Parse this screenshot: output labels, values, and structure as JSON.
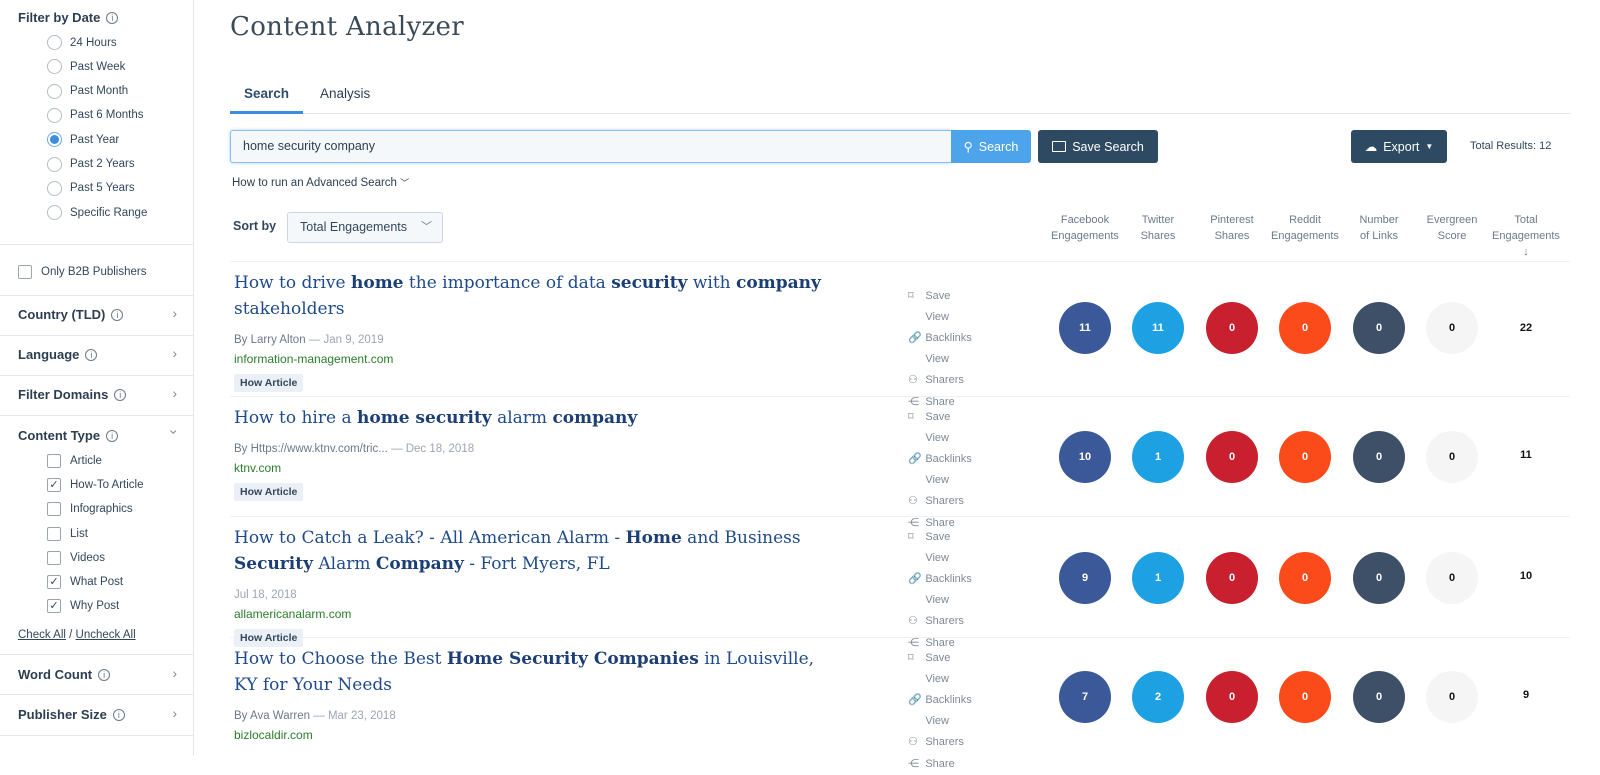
{
  "sidebar": {
    "date_title": "Filter by Date",
    "date_options": [
      "24 Hours",
      "Past Week",
      "Past Month",
      "Past 6 Months",
      "Past Year",
      "Past 2 Years",
      "Past 5 Years",
      "Specific Range"
    ],
    "date_selected": "Past Year",
    "b2b": "Only B2B Publishers",
    "country": "Country (TLD)",
    "language": "Language",
    "domains": "Filter Domains",
    "content_type": "Content Type",
    "types": [
      {
        "label": "Article",
        "checked": false
      },
      {
        "label": "How-To Article",
        "checked": true
      },
      {
        "label": "Infographics",
        "checked": false
      },
      {
        "label": "List",
        "checked": false
      },
      {
        "label": "Videos",
        "checked": false
      },
      {
        "label": "What Post",
        "checked": true
      },
      {
        "label": "Why Post",
        "checked": true
      }
    ],
    "check_all": "Check All",
    "sep": "/",
    "uncheck_all": "Uncheck All",
    "word_count": "Word Count",
    "publisher_size": "Publisher Size"
  },
  "main": {
    "title": "Content Analyzer",
    "tabs": [
      "Search",
      "Analysis"
    ],
    "search_value": "home security company",
    "search_btn": "Search",
    "save_search": "Save Search",
    "export": "Export",
    "total_results": "Total Results: 12",
    "advanced": "How to run an Advanced Search",
    "sort_label": "Sort by",
    "sort_value": "Total Engagements",
    "columns": [
      [
        "Facebook",
        "Engagements"
      ],
      [
        "Twitter",
        "Shares"
      ],
      [
        "Pinterest",
        "Shares"
      ],
      [
        "Reddit",
        "Engagements"
      ],
      [
        "Number",
        "of Links"
      ],
      [
        "Evergreen",
        "Score"
      ],
      [
        "Total",
        "Engagements"
      ]
    ],
    "sort_arrow": "↓",
    "actions": [
      "Save",
      "View Backlinks",
      "View Sharers",
      "Share"
    ]
  },
  "colors": {
    "facebook": "#3b5998",
    "twitter": "#1da1e2",
    "pinterest": "#c8202f",
    "reddit": "#fc4b1b",
    "links": "#3e5068",
    "evergreen": "#f5f5f5"
  },
  "results": [
    {
      "title_html": "How to drive <b>home</b> the importance of data <b>security</b> with <b>company</b> stakeholders",
      "author": "By Larry Alton",
      "date": "— Jan 9, 2019",
      "domain": "information-management.com",
      "tag": "How Article",
      "values": [
        "11",
        "11",
        "0",
        "0",
        "0",
        "0",
        "22"
      ]
    },
    {
      "title_html": "How to hire a <b>home security</b> alarm <b>company</b>",
      "author": "By Https://www.ktnv.com/tric...",
      "date": "— Dec 18, 2018",
      "domain": "ktnv.com",
      "tag": "How Article",
      "values": [
        "10",
        "1",
        "0",
        "0",
        "0",
        "0",
        "11"
      ]
    },
    {
      "title_html": "How to Catch a Leak? - All American Alarm - <b>Home</b> and Business <b>Security</b> Alarm <b>Company</b> - Fort Myers, FL",
      "author": "",
      "date": "Jul 18, 2018",
      "domain": "allamericanalarm.com",
      "tag": "How Article",
      "values": [
        "9",
        "1",
        "0",
        "0",
        "0",
        "0",
        "10"
      ]
    },
    {
      "title_html": "How to Choose the Best <b>Home Security Companies</b> in Louisville, KY for Your Needs",
      "author": "By Ava Warren",
      "date": "— Mar 23, 2018",
      "domain": "bizlocaldir.com",
      "tag": "",
      "values": [
        "7",
        "2",
        "0",
        "0",
        "0",
        "0",
        "9"
      ]
    }
  ]
}
